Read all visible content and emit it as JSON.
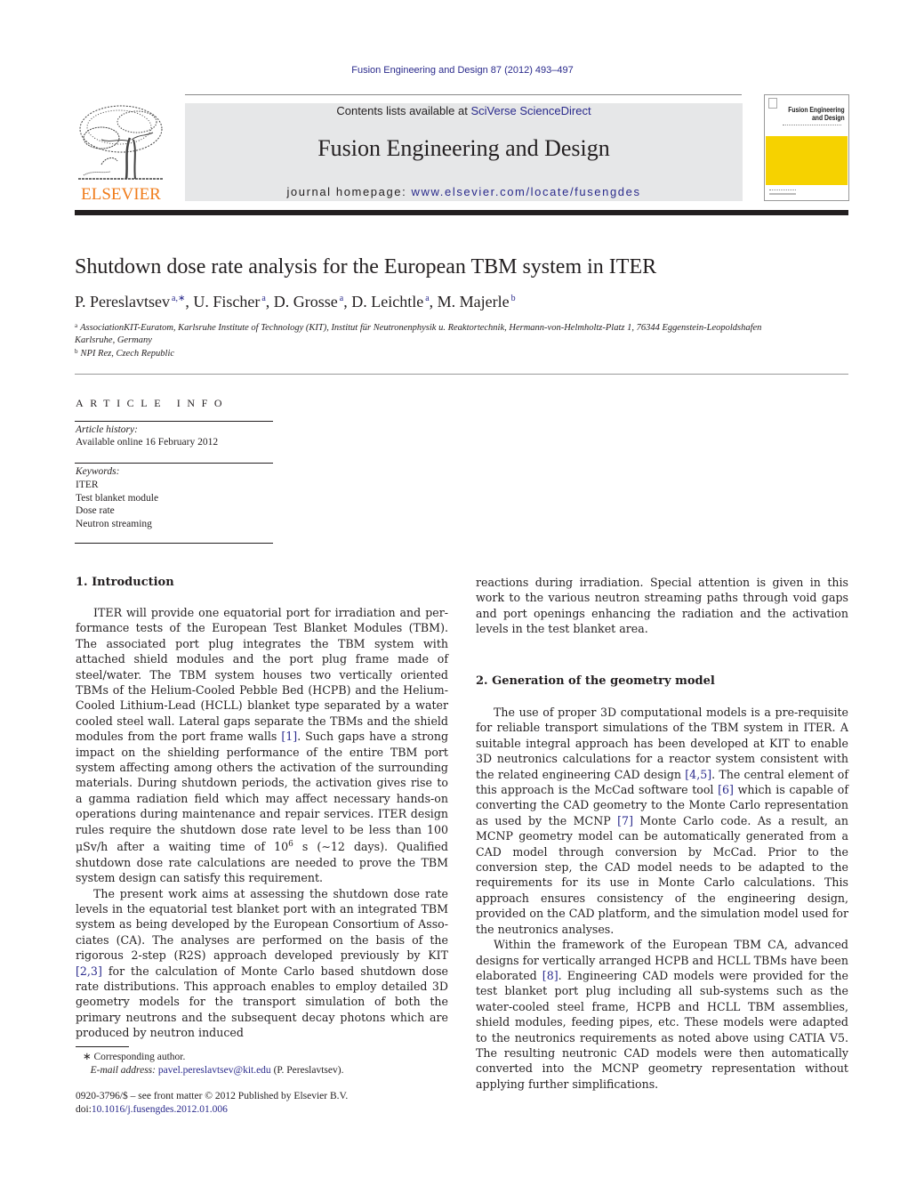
{
  "citation": "Fusion Engineering and Design 87 (2012) 493–497",
  "masthead": {
    "contents_prefix": "Contents lists available at ",
    "contents_link": "SciVerse ScienceDirect",
    "journal_title": "Fusion Engineering and Design",
    "homepage_prefix": "journal homepage: ",
    "homepage_link": "www.elsevier.com/locate/fusengdes",
    "publisher_logo_text": "ELSEVIER",
    "cover_title_line1": "Fusion Engineering",
    "cover_title_line2": "and Design"
  },
  "colors": {
    "link": "#2a2a8c",
    "elsevier_orange": "#f07c1b",
    "masthead_bg": "#e6e7e8",
    "cover_yellow": "#f6d200"
  },
  "article": {
    "title": "Shutdown dose rate analysis for the European TBM system in ITER",
    "authors": [
      {
        "name": "P. Pereslavtsev",
        "sup": "a,∗"
      },
      {
        "name": "U. Fischer",
        "sup": "a"
      },
      {
        "name": "D. Grosse",
        "sup": "a"
      },
      {
        "name": "D. Leichtle",
        "sup": "a"
      },
      {
        "name": "M. Majerle",
        "sup": "b"
      }
    ],
    "affiliations": [
      {
        "key": "a",
        "text": "AssociationKIT-Euratom, Karlsruhe Institute of Technology (KIT), Institut für Neutronenphysik u. Reaktortechnik, Hermann-von-Helmholtz-Platz 1, 76344 Eggenstein-Leopoldshafen",
        "text_cont": "Karlsruhe, Germany"
      },
      {
        "key": "b",
        "text": "NPI Rez, Czech Republic"
      }
    ]
  },
  "article_info": {
    "heading": "ARTICLE INFO",
    "history_label": "Article history:",
    "history_value": "Available online 16 February 2012",
    "keywords_label": "Keywords:",
    "keywords": [
      "ITER",
      "Test blanket module",
      "Dose rate",
      "Neutron streaming"
    ]
  },
  "sections": {
    "s1_heading": "1.  Introduction",
    "s1_p1_a": "ITER will provide one equatorial port for irradiation and per­formance tests of the European Test Blanket Modules (TBM). The associated port plug integrates the TBM system with attached shield modules and the port plug frame made of steel/water. The TBM system houses two vertically oriented TBMs of the Helium-Cooled Pebble Bed (HCPB) and the Helium-Cooled Lithium-Lead (HCLL) blanket type separated by a water cooled steel wall. Lateral gaps separate the TBMs and the shield modules from the port frame walls ",
    "s1_p1_ref1": "[1]",
    "s1_p1_b": ". Such gaps have a strong impact on the shielding perfor­mance of the entire TBM port system affecting among others the activation of the surrounding materials. During shutdown periods, the activation gives rise to a gamma radiation field which may affect necessary hands-on operations during maintenance and repair ser­vices. ITER design rules require the shutdown dose rate level to be less than 100 μSv/h after a waiting time of 10",
    "s1_p1_exp": "6",
    "s1_p1_c": " s (∼12 days). Quali­fied shutdown dose rate calculations are needed to prove the TBM system design can satisfy this requirement.",
    "s1_p2_a": "The present work aims at assessing the shutdown dose rate levels in the equatorial test blanket port with an integrated TBM system as being developed by the European Consortium of Asso­ciates (CA). The analyses are performed on the basis of the rigorous 2-step (R2S) approach developed previously by KIT ",
    "s1_p2_ref": "[2,3]",
    "s1_p2_b": " for the cal­culation of Monte Carlo based shutdown dose rate distributions. This approach enables to employ detailed 3D geometry models for the transport simulation of both the primary neutrons and the subsequent decay photons which are produced by neutron induced",
    "s1_p2_cont": "reactions during irradiation. Special attention is given in this work to the various neutron streaming paths through void gaps and port openings enhancing the radiation and the activation levels in the test blanket area.",
    "s2_heading": "2.  Generation of the geometry model",
    "s2_p1_a": "The use of proper 3D computational models is a pre-requisite for reliable transport simulations of the TBM system in ITER. A suitable integral approach has been developed at KIT to enable 3D neutron­ics calculations for a reactor system consistent with the related engineering CAD design ",
    "s2_p1_ref1": "[4,5]",
    "s2_p1_b": ". The central element of this approach is the McCad software tool ",
    "s2_p1_ref2": "[6]",
    "s2_p1_c": " which is capable of converting the CAD geometry to the Monte Carlo representation as used by the MCNP ",
    "s2_p1_ref3": "[7]",
    "s2_p1_d": " Monte Carlo code. As a result, an MCNP geometry model can be automatically generated from a CAD model through conver­sion by McCad. Prior to the conversion step, the CAD model needs to be adapted to the requirements for its use in Monte Carlo calcula­tions. This approach ensures consistency of the engineering design, provided on the CAD platform, and the simulation model used for the neutronics analyses.",
    "s2_p2_a": "Within the framework of the European TBM CA, advanced designs for vertically arranged HCPB and HCLL TBMs have been elaborated ",
    "s2_p2_ref": "[8]",
    "s2_p2_b": ". Engineering CAD models were provided for the test blanket port plug including all sub-systems such as the water-cooled steel frame, HCPB and HCLL TBM assemblies, shield modules, feeding pipes, etc. These models were adapted to the neutronics requirements as noted above using CATIA V5. The resulting neu­tronic CAD models were then automatically converted into the MCNP geometry representation without applying further simpli­fications."
  },
  "footnote": {
    "marker": "∗",
    "corresponding": "Corresponding author.",
    "email_label": "E-mail address:",
    "email": "pavel.pereslavtsev@kit.edu",
    "email_owner": "(P. Pereslavtsev)."
  },
  "front_matter": {
    "issn_line": "0920-3796/$ – see front matter © 2012 Published by Elsevier B.V.",
    "doi_prefix": "doi:",
    "doi": "10.1016/j.fusengdes.2012.01.006"
  }
}
